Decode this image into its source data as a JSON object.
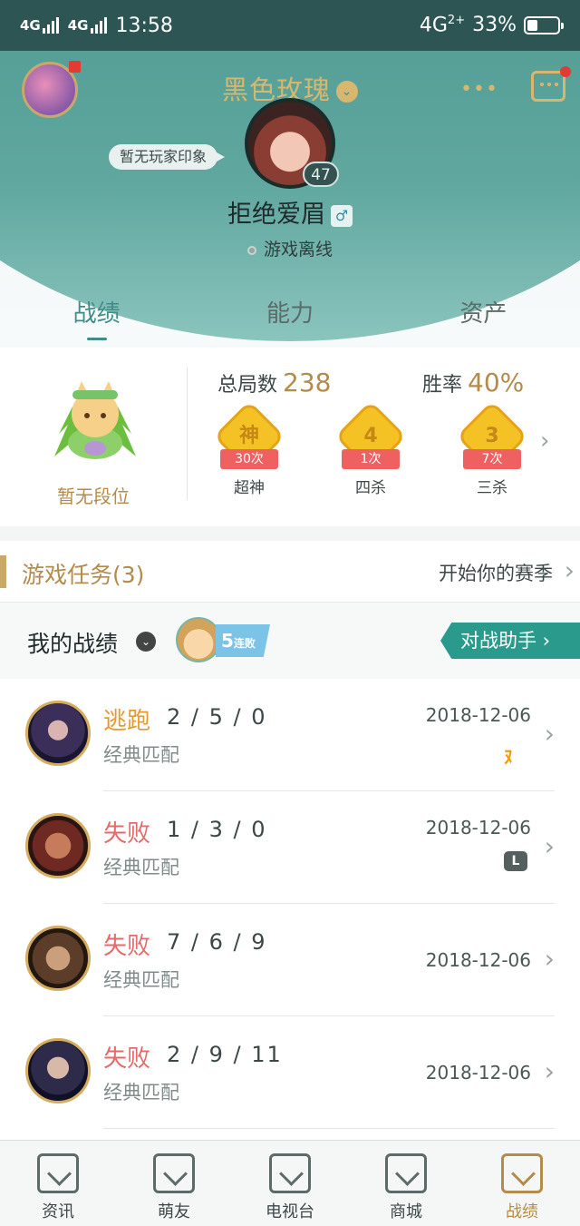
{
  "statusbar": {
    "net1": "4G",
    "net2": "4G",
    "time": "13:58",
    "net3": "4G",
    "net3_sub": "2+",
    "battery": "33%",
    "battery_level": 0.33
  },
  "header": {
    "nickname": "黑色玫瑰",
    "more": "•••",
    "impression": "暂无玩家印象",
    "level": "47",
    "username": "拒绝爱眉",
    "gender_symbol": "♂",
    "online_status": "游戏离线"
  },
  "tabs": [
    {
      "label": "战绩"
    },
    {
      "label": "能力"
    },
    {
      "label": "资产"
    }
  ],
  "stats": {
    "rank_label": "暂无段位",
    "total_label": "总局数",
    "total_value": "238",
    "winrate_label": "胜率",
    "winrate_value": "40%",
    "badges": [
      {
        "glyph": "神",
        "count": "30次",
        "name": "超神"
      },
      {
        "glyph": "4",
        "count": "1次",
        "name": "四杀"
      },
      {
        "glyph": "3",
        "count": "7次",
        "name": "三杀"
      }
    ]
  },
  "tasks": {
    "title": "游戏任务(3)",
    "link": "开始你的赛季"
  },
  "record": {
    "title": "我的战绩",
    "streak_num": "5",
    "streak_text": "连败",
    "assistant": "对战助手 ›"
  },
  "matches": [
    {
      "result": "逃跑",
      "kda": "2 / 5 / 0",
      "mode": "经典匹配",
      "date": "2018-12-06",
      "result_color": "#e69a2e"
    },
    {
      "result": "失败",
      "kda": "1 / 3 / 0",
      "mode": "经典匹配",
      "date": "2018-12-06",
      "result_color": "#e56a6a"
    },
    {
      "result": "失败",
      "kda": "7 / 6 / 9",
      "mode": "经典匹配",
      "date": "2018-12-06",
      "result_color": "#e56a6a"
    },
    {
      "result": "失败",
      "kda": "2 / 9 / 11",
      "mode": "经典匹配",
      "date": "2018-12-06",
      "result_color": "#e56a6a"
    }
  ],
  "bottom_nav": [
    {
      "label": "资讯",
      "icon": "news-icon"
    },
    {
      "label": "萌友",
      "icon": "friends-icon"
    },
    {
      "label": "电视台",
      "icon": "tv-icon"
    },
    {
      "label": "商城",
      "icon": "store-icon"
    },
    {
      "label": "战绩",
      "icon": "record-icon"
    }
  ],
  "colors": {
    "accent": "#3f8d86",
    "gold": "#b38b4a",
    "loss": "#e56a6a",
    "flee": "#e69a2e"
  }
}
